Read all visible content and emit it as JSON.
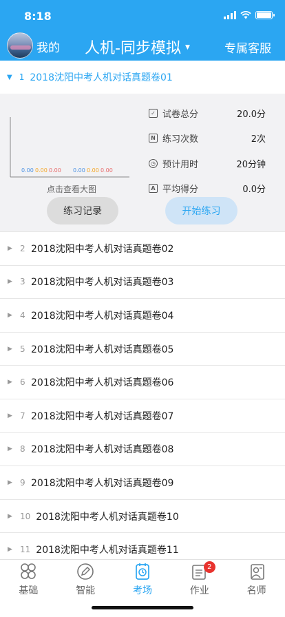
{
  "status_bar": {
    "time": "8:18"
  },
  "navbar": {
    "mine": "我的",
    "title": "人机-同步模拟",
    "service": "专属客服"
  },
  "expanded": {
    "number": "1",
    "title": "2018沈阳中考人机对话真题卷01",
    "chart_caption": "点击查看大图",
    "chart_labels": {
      "group1": [
        "0.00",
        "0.00",
        "0.00"
      ],
      "group2": [
        "0.00",
        "0.00",
        "0.00"
      ],
      "colors": [
        "#4a90e2",
        "#f5a623",
        "#e86a6a"
      ]
    },
    "stats": [
      {
        "icon": "check-box-icon",
        "label": "试卷总分",
        "value": "20.0分"
      },
      {
        "icon": "n-box-icon",
        "label": "练习次数",
        "value": "2次"
      },
      {
        "icon": "clock-icon",
        "label": "预计用时",
        "value": "20分钟"
      },
      {
        "icon": "a-box-icon",
        "label": "平均得分",
        "value": "0.0分"
      }
    ],
    "btn_records": "练习记录",
    "btn_start": "开始练习"
  },
  "list": [
    {
      "num": "2",
      "title": "2018沈阳中考人机对话真题卷02"
    },
    {
      "num": "3",
      "title": "2018沈阳中考人机对话真题卷03"
    },
    {
      "num": "4",
      "title": "2018沈阳中考人机对话真题卷04"
    },
    {
      "num": "5",
      "title": "2018沈阳中考人机对话真题卷05"
    },
    {
      "num": "6",
      "title": "2018沈阳中考人机对话真题卷06"
    },
    {
      "num": "7",
      "title": "2018沈阳中考人机对话真题卷07"
    },
    {
      "num": "8",
      "title": "2018沈阳中考人机对话真题卷08"
    },
    {
      "num": "9",
      "title": "2018沈阳中考人机对话真题卷09"
    },
    {
      "num": "10",
      "title": "2018沈阳中考人机对话真题卷10"
    },
    {
      "num": "11",
      "title": "2018沈阳中考人机对话真题卷11"
    }
  ],
  "tabs": [
    {
      "label": "基础",
      "icon": "clover-icon",
      "active": false
    },
    {
      "label": "智能",
      "icon": "pencil-circle-icon",
      "active": false
    },
    {
      "label": "考场",
      "icon": "exam-clock-icon",
      "active": true
    },
    {
      "label": "作业",
      "icon": "clipboard-icon",
      "active": false,
      "badge": "2"
    },
    {
      "label": "名师",
      "icon": "teacher-icon",
      "active": false
    }
  ],
  "colors": {
    "primary": "#2ba6f2",
    "badge": "#e8332e"
  }
}
